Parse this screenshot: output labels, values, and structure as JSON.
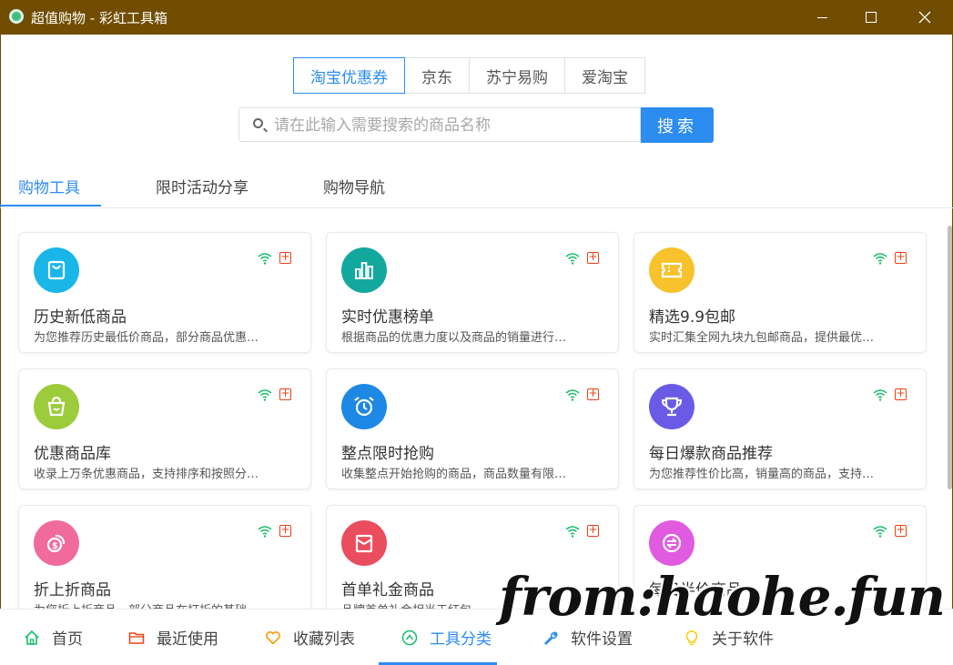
{
  "window": {
    "title": "超值购物 - 彩虹工具箱"
  },
  "platform_tabs": [
    {
      "label": "淘宝优惠券",
      "active": true
    },
    {
      "label": "京东",
      "active": false
    },
    {
      "label": "苏宁易购",
      "active": false
    },
    {
      "label": "爱淘宝",
      "active": false
    }
  ],
  "search": {
    "placeholder": "请在此输入需要搜索的商品名称",
    "value": "",
    "button_label": "搜索"
  },
  "tabs": [
    {
      "label": "购物工具",
      "active": true
    },
    {
      "label": "限时活动分享",
      "active": false
    },
    {
      "label": "购物导航",
      "active": false
    }
  ],
  "cards": [
    {
      "title": "历史新低商品",
      "desc": "为您推荐历史最低价商品，部分商品优惠…",
      "icon": "shopping-bag-icon",
      "color": "#1ab6e8"
    },
    {
      "title": "实时优惠榜单",
      "desc": "根据商品的优惠力度以及商品的销量进行…",
      "icon": "bar-chart-icon",
      "color": "#13a89e"
    },
    {
      "title": "精选9.9包邮",
      "desc": "实时汇集全网九块九包邮商品，提供最优…",
      "icon": "ticket-icon",
      "color": "#f7c22b"
    },
    {
      "title": "优惠商品库",
      "desc": "收录上万条优惠商品，支持排序和按照分…",
      "icon": "basket-icon",
      "color": "#9ccb3b"
    },
    {
      "title": "整点限时抢购",
      "desc": "收集整点开始抢购的商品，商品数量有限…",
      "icon": "alarm-clock-icon",
      "color": "#1e88e5"
    },
    {
      "title": "每日爆款商品推荐",
      "desc": "为您推荐性价比高，销量高的商品，支持…",
      "icon": "trophy-icon",
      "color": "#6a5be6"
    },
    {
      "title": "折上折商品",
      "desc": "为您折上折商品，部分商品在打折的基础…",
      "icon": "coins-icon",
      "color": "#f06b9b"
    },
    {
      "title": "首单礼金商品",
      "desc": "品牌首单礼金相当于红包…",
      "icon": "red-envelope-icon",
      "color": "#ea4d5d"
    },
    {
      "title": "每日半价商品",
      "desc": "",
      "icon": "half-price-icon",
      "color": "#e05be0"
    }
  ],
  "bottom_nav": [
    {
      "label": "首页",
      "icon": "home-icon",
      "active": false
    },
    {
      "label": "最近使用",
      "icon": "folder-icon",
      "active": false
    },
    {
      "label": "收藏列表",
      "icon": "heart-icon",
      "active": false
    },
    {
      "label": "工具分类",
      "icon": "compass-icon",
      "active": true
    },
    {
      "label": "软件设置",
      "icon": "wrench-icon",
      "active": false
    },
    {
      "label": "关于软件",
      "icon": "bulb-icon",
      "active": false
    }
  ],
  "watermark": "from:haohe.fun"
}
